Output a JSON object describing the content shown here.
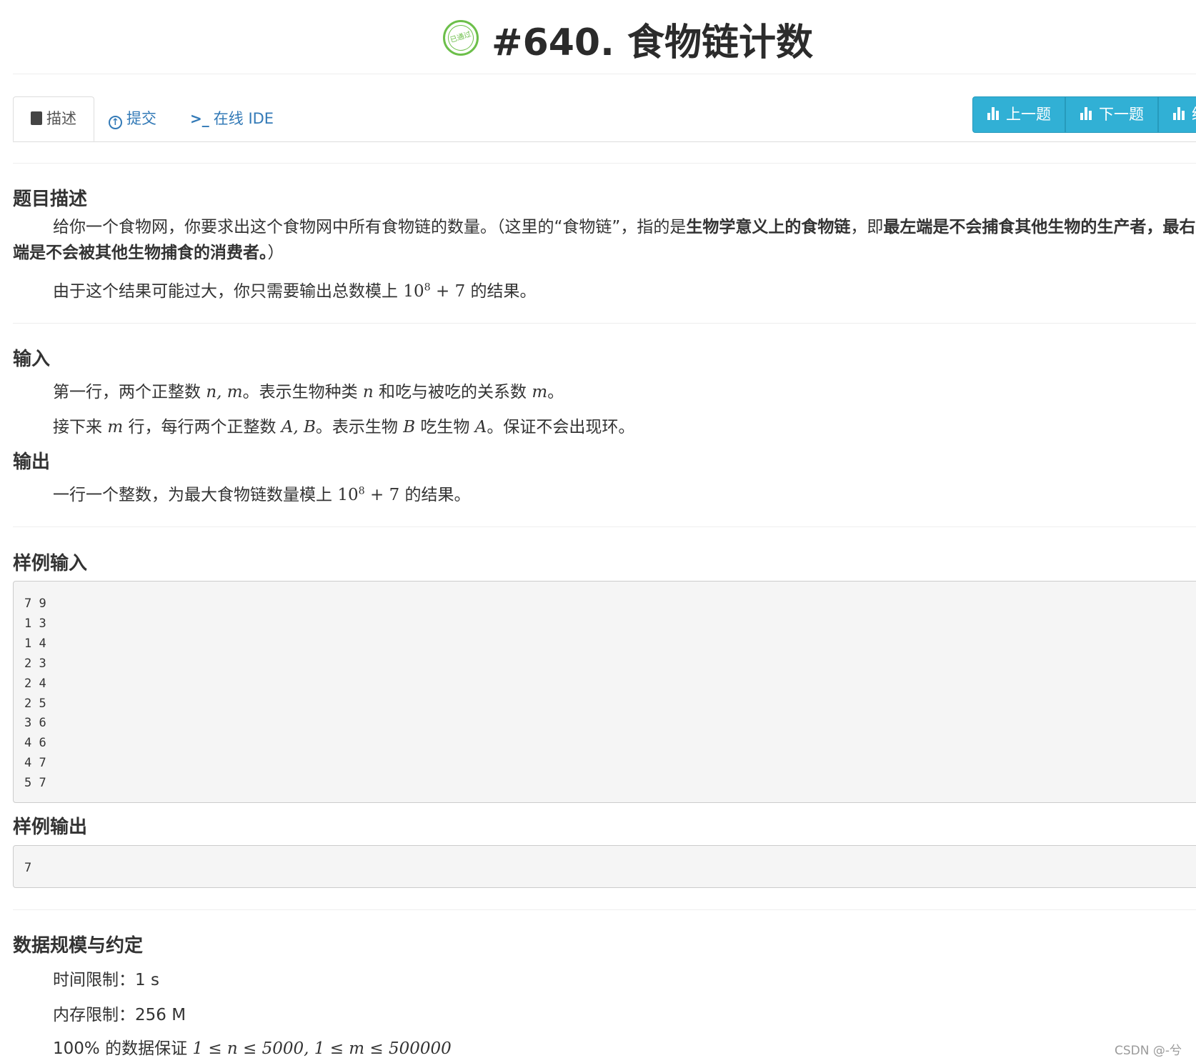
{
  "header": {
    "badge": "已通过",
    "title": "#640. 食物链计数"
  },
  "tabs": [
    {
      "label": "描述"
    },
    {
      "label": "提交"
    },
    {
      "label": "在线 IDE"
    }
  ],
  "nav": {
    "prev": "上一题",
    "next": "下一题",
    "third": "统"
  },
  "desc": {
    "heading": "题目描述",
    "p1_a": "给你一个食物网，你要求出这个食物网中所有食物链的数量。（这里的“食物链”，指的是",
    "p1_b": "生物学意义上的食物链",
    "p1_c": "，即",
    "p1_d": "最左端是不会捕食其他生物的生产者，最右端是不会被其他生物捕食的消费者。",
    "p1_e": "）",
    "p2_a": "由于这个结果可能过大，你只需要输出总数模上",
    "p2_b": "的结果。"
  },
  "input": {
    "heading": "输入",
    "l1_a": "第一行，两个正整数",
    "l1_b": "。表示生物种类",
    "l1_c": "和吃与被吃的关系数",
    "l2_a": "接下来",
    "l2_b": "行，每行两个正整数",
    "l2_c": "。表示生物",
    "l2_d": "吃生物",
    "l2_e": "。保证不会出现环。"
  },
  "output": {
    "heading": "输出",
    "l1_a": "一行一个整数，为最大食物链数量模上",
    "l1_b": "的结果。"
  },
  "sample_in": {
    "heading": "样例输入",
    "text": "7 9\n1 3\n1 4\n2 3\n2 4\n2 5\n3 6\n4 6\n4 7\n5 7"
  },
  "sample_out": {
    "heading": "样例输出",
    "text": "7"
  },
  "limits": {
    "heading": "数据规模与约定",
    "time": "时间限制：1 s",
    "memory": "内存限制：256 M",
    "guarantee": "100% 的数据保证"
  },
  "watermark": "CSDN @-兮"
}
